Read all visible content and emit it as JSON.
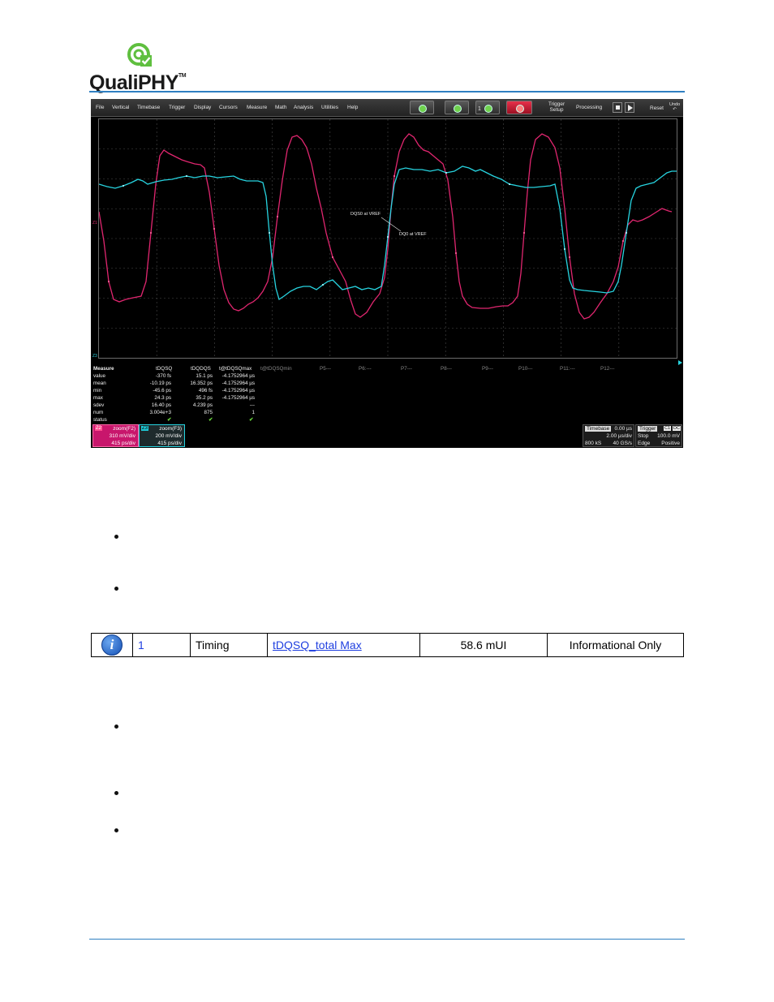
{
  "logo": {
    "text": "QualiPHY",
    "tm": "TM"
  },
  "scope": {
    "menu": [
      "File",
      "Vertical",
      "Timebase",
      "Trigger",
      "Display",
      "Cursors",
      "Measure",
      "Math",
      "Analysis",
      "Utilities",
      "Help"
    ],
    "toolbar": {
      "trigger_setup_line1": "Trigger",
      "trigger_setup_line2": "Setup",
      "processing": "Processing",
      "reset": "Reset",
      "undo_line1": "Undo",
      "undo_line2": "↶",
      "count_label": "1"
    },
    "annotations": {
      "dqs": "DQS0 at VREF",
      "dq": "DQ0 at VREF"
    },
    "channel_markers": {
      "ch_upper": "Z1",
      "ch_lower": "Z3"
    },
    "measure": {
      "header": [
        "Measure",
        "tDQSQ",
        "tDQDQS",
        "t@tDQSQmax",
        "t@tDQSQmin",
        "P5---",
        "P6:---",
        "P7---",
        "P8---",
        "P9---",
        "P10---",
        "P11:---",
        "P12---"
      ],
      "rows": [
        {
          "label": "value",
          "c1": "-370 fs",
          "c2": "15.1 ps",
          "c3": "-4.1752964 µs"
        },
        {
          "label": "mean",
          "c1": "-10.19 ps",
          "c2": "16.352 ps",
          "c3": "-4.1752964 µs"
        },
        {
          "label": "min",
          "c1": "-45.6 ps",
          "c2": "496 fs",
          "c3": "-4.1752964 µs"
        },
        {
          "label": "max",
          "c1": "24.3 ps",
          "c2": "35.2 ps",
          "c3": "-4.1752964 µs"
        },
        {
          "label": "sdev",
          "c1": "16.40 ps",
          "c2": "4.239 ps",
          "c3": "---"
        },
        {
          "label": "num",
          "c1": "3.004e+3",
          "c2": "875",
          "c3": "1"
        },
        {
          "label": "status",
          "c1": "✔",
          "c2": "✔",
          "c3": "✔"
        }
      ]
    },
    "z2_box": {
      "tag": "Z2",
      "title": "zoom(F2)",
      "line1": "310 mV/div",
      "line2": "415 ps/div",
      "color": "#c8166c"
    },
    "z3_box": {
      "tag": "Z3",
      "title": "zoom(F3)",
      "line1": "200 mV/div",
      "line2": "415 ps/div",
      "color": "#1fc9d6"
    },
    "timebase_box": {
      "title": "Timebase",
      "offset": "0.00 µs",
      "rate_per_div": "2.00 µs/div",
      "samples": "800 kS",
      "sample_rate": "40 GS/s"
    },
    "trigger_box": {
      "title": "Trigger",
      "ch": "C1",
      "dc": "DC",
      "mode": "Stop",
      "level": "100.0 mV",
      "type": "Edge",
      "slope": "Positive"
    }
  },
  "result_row": {
    "index": "1",
    "category": "Timing",
    "test_name": "tDQSQ_total Max",
    "value": "58.6 mUI",
    "status": "Informational Only"
  },
  "colors": {
    "accent": "#2f7fc1",
    "dqs_trace": "#e0266f",
    "dq_trace": "#27d4e0",
    "link": "#1f3fe0"
  }
}
